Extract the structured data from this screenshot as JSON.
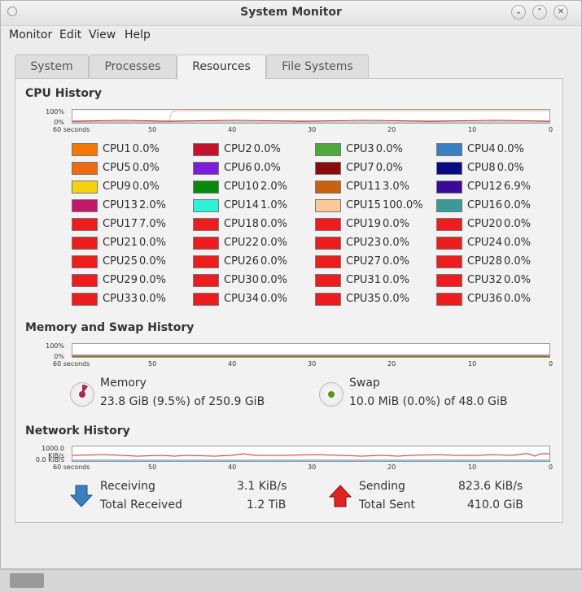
{
  "window": {
    "title": "System Monitor"
  },
  "menu": [
    "Monitor",
    "Edit",
    "View",
    "Help"
  ],
  "tabs": [
    "System",
    "Processes",
    "Resources",
    "File Systems"
  ],
  "active_tab": "Resources",
  "cpu_section": {
    "title": "CPU History",
    "y_labels": [
      "100%",
      "0%"
    ],
    "x_labels": [
      "60 seconds",
      "50",
      "40",
      "30",
      "20",
      "10",
      "0"
    ],
    "cpus": [
      {
        "name": "CPU1",
        "value": "0.0%",
        "color": "#f57900"
      },
      {
        "name": "CPU2",
        "value": "0.0%",
        "color": "#c4122c"
      },
      {
        "name": "CPU3",
        "value": "0.0%",
        "color": "#4fa83d"
      },
      {
        "name": "CPU4",
        "value": "0.0%",
        "color": "#3a7fc1"
      },
      {
        "name": "CPU5",
        "value": "0.0%",
        "color": "#ef6b12"
      },
      {
        "name": "CPU6",
        "value": "0.0%",
        "color": "#7a1fd6"
      },
      {
        "name": "CPU7",
        "value": "0.0%",
        "color": "#8a0b0b"
      },
      {
        "name": "CPU8",
        "value": "0.0%",
        "color": "#0a0a85"
      },
      {
        "name": "CPU9",
        "value": "0.0%",
        "color": "#f5d20a"
      },
      {
        "name": "CPU10",
        "value": "2.0%",
        "color": "#0a8a0a"
      },
      {
        "name": "CPU11",
        "value": "3.0%",
        "color": "#c9620a"
      },
      {
        "name": "CPU12",
        "value": "6.9%",
        "color": "#3b0a9a"
      },
      {
        "name": "CPU13",
        "value": "2.0%",
        "color": "#c21868"
      },
      {
        "name": "CPU14",
        "value": "1.0%",
        "color": "#2af2d2"
      },
      {
        "name": "CPU15",
        "value": "100.0%",
        "color": "#f9c99a"
      },
      {
        "name": "CPU16",
        "value": "0.0%",
        "color": "#3c9a96"
      },
      {
        "name": "CPU17",
        "value": "7.0%",
        "color": "#ee1c1c"
      },
      {
        "name": "CPU18",
        "value": "0.0%",
        "color": "#ee1c1c"
      },
      {
        "name": "CPU19",
        "value": "0.0%",
        "color": "#ee1c1c"
      },
      {
        "name": "CPU20",
        "value": "0.0%",
        "color": "#ee1c1c"
      },
      {
        "name": "CPU21",
        "value": "0.0%",
        "color": "#ee1c1c"
      },
      {
        "name": "CPU22",
        "value": "0.0%",
        "color": "#ee1c1c"
      },
      {
        "name": "CPU23",
        "value": "0.0%",
        "color": "#ee1c1c"
      },
      {
        "name": "CPU24",
        "value": "0.0%",
        "color": "#ee1c1c"
      },
      {
        "name": "CPU25",
        "value": "0.0%",
        "color": "#ee1c1c"
      },
      {
        "name": "CPU26",
        "value": "0.0%",
        "color": "#ee1c1c"
      },
      {
        "name": "CPU27",
        "value": "0.0%",
        "color": "#ee1c1c"
      },
      {
        "name": "CPU28",
        "value": "0.0%",
        "color": "#ee1c1c"
      },
      {
        "name": "CPU29",
        "value": "0.0%",
        "color": "#ee1c1c"
      },
      {
        "name": "CPU30",
        "value": "0.0%",
        "color": "#ee1c1c"
      },
      {
        "name": "CPU31",
        "value": "0.0%",
        "color": "#ee1c1c"
      },
      {
        "name": "CPU32",
        "value": "0.0%",
        "color": "#ee1c1c"
      },
      {
        "name": "CPU33",
        "value": "0.0%",
        "color": "#ee1c1c"
      },
      {
        "name": "CPU34",
        "value": "0.0%",
        "color": "#ee1c1c"
      },
      {
        "name": "CPU35",
        "value": "0.0%",
        "color": "#ee1c1c"
      },
      {
        "name": "CPU36",
        "value": "0.0%",
        "color": "#ee1c1c"
      }
    ]
  },
  "memory_section": {
    "title": "Memory and Swap History",
    "y_labels": [
      "100%",
      "0%"
    ],
    "x_labels": [
      "60 seconds",
      "50",
      "40",
      "30",
      "20",
      "10",
      "0"
    ],
    "memory": {
      "label": "Memory",
      "detail": "23.8 GiB (9.5%) of 250.9 GiB",
      "color": "#b3264c"
    },
    "swap": {
      "label": "Swap",
      "detail": "10.0 MiB (0.0%) of 48.0 GiB",
      "color": "#4e9a06"
    }
  },
  "network_section": {
    "title": "Network History",
    "y_labels": [
      "1000.0 KiB/s",
      "0.0 KiB/s"
    ],
    "x_labels": [
      "60 seconds",
      "50",
      "40",
      "30",
      "20",
      "10",
      "0"
    ],
    "receiving": {
      "label": "Receiving",
      "value": "3.1 KiB/s",
      "total_label": "Total Received",
      "total": "1.2 TiB",
      "color": "#3a7fc1"
    },
    "sending": {
      "label": "Sending",
      "value": "823.6 KiB/s",
      "total_label": "Total Sent",
      "total": "410.0 GiB",
      "color": "#e02424"
    }
  }
}
